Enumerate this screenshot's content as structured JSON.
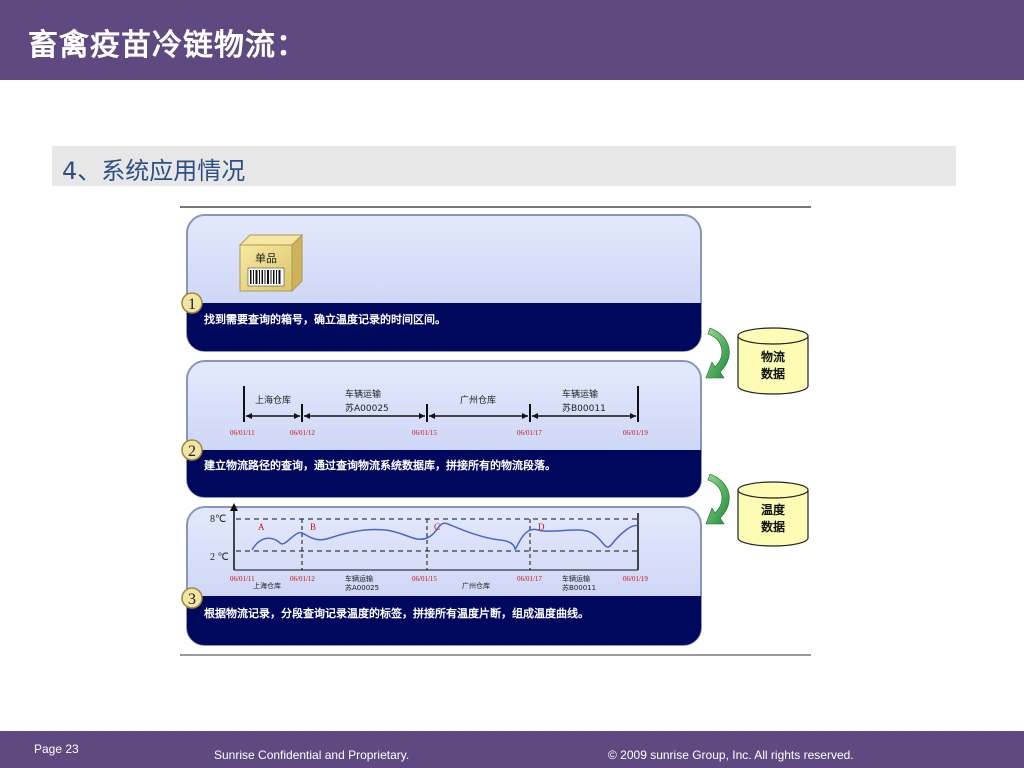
{
  "header": {
    "title": "畜禽疫苗冷链物流："
  },
  "section": {
    "title": "4、系统应用情况"
  },
  "figure": {
    "panel1": {
      "step": "1",
      "box_label": "单品",
      "caption": "找到需要查询的箱号，确立温度记录的时间区间。"
    },
    "panel2": {
      "step": "2",
      "caption": "建立物流路径的查询，通过查询物流系统数据库，拼接所有的物流段落。",
      "segments": [
        {
          "line1": "上海仓库",
          "line2": ""
        },
        {
          "line1": "车辆运输",
          "line2": "苏A00025"
        },
        {
          "line1": "广州仓库",
          "line2": ""
        },
        {
          "line1": "车辆运输",
          "line2": "苏B00011"
        }
      ],
      "dates": [
        "06/01/11",
        "06/01/12",
        "06/01/15",
        "06/01/17",
        "06/01/19"
      ]
    },
    "panel3": {
      "step": "3",
      "caption": "根据物流记录，分段查询记录温度的标签，拼接所有温度片断，组成温度曲线。",
      "y_high": "8℃",
      "y_low": "2 ℃",
      "markers": [
        "A",
        "B",
        "C",
        "D"
      ],
      "dates": [
        "06/01/11",
        "06/01/12",
        "06/01/15",
        "06/01/17",
        "06/01/19"
      ],
      "segments": [
        {
          "line1": "上海仓库",
          "line2": ""
        },
        {
          "line1": "车辆运输",
          "line2": "苏A00025"
        },
        {
          "line1": "广州仓库",
          "line2": ""
        },
        {
          "line1": "车辆运输",
          "line2": "苏B00011"
        }
      ]
    },
    "db1": {
      "line1": "物流",
      "line2": "数据"
    },
    "db2": {
      "line1": "温度",
      "line2": "数据"
    }
  },
  "footer": {
    "page": "Page 23",
    "confidential": "Sunrise Confidential and Proprietary.",
    "copyright": "© 2009 sunrise Group, Inc.  All rights reserved."
  },
  "colors": {
    "header_bg": "#5e4a80",
    "panel_bg": "#d3dcf7",
    "caption_bg": "#00085e",
    "db_fill": "#fdfcb4",
    "curve": "#4a66c8",
    "date_red": "#cc1111"
  }
}
